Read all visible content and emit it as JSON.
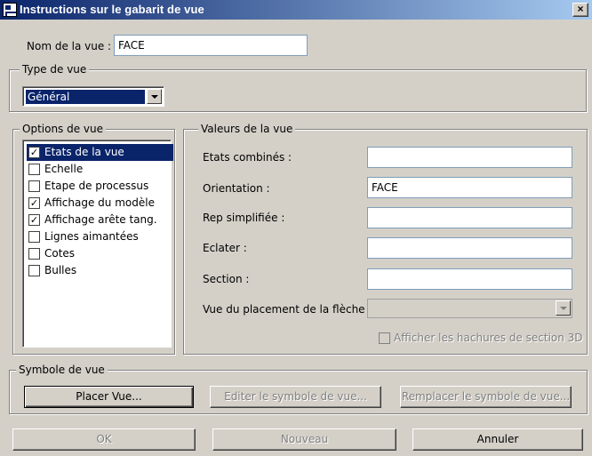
{
  "window": {
    "title": "Instructions sur le gabarit de vue",
    "close_glyph": "×"
  },
  "view_name": {
    "label": "Nom de la vue :",
    "value": "FACE"
  },
  "view_type": {
    "legend": "Type de vue",
    "selected": "Général"
  },
  "view_options": {
    "legend": "Options de vue",
    "items": [
      {
        "label": "Etats de la vue",
        "checked": true,
        "selected": true
      },
      {
        "label": "Echelle",
        "checked": false,
        "selected": false
      },
      {
        "label": "Etape de processus",
        "checked": false,
        "selected": false
      },
      {
        "label": "Affichage du modèle",
        "checked": true,
        "selected": false
      },
      {
        "label": "Affichage arête tang.",
        "checked": true,
        "selected": false
      },
      {
        "label": "Lignes aimantées",
        "checked": false,
        "selected": false
      },
      {
        "label": "Cotes",
        "checked": false,
        "selected": false
      },
      {
        "label": "Bulles",
        "checked": false,
        "selected": false
      }
    ],
    "check_glyph": "✓"
  },
  "view_values": {
    "legend": "Valeurs de la vue",
    "fields": [
      {
        "label": "Etats combinés :",
        "value": ""
      },
      {
        "label": "Orientation :",
        "value": "FACE"
      },
      {
        "label": "Rep simplifiée :",
        "value": ""
      },
      {
        "label": "Eclater :",
        "value": ""
      },
      {
        "label": "Section :",
        "value": ""
      }
    ],
    "arrow_placement_label": "Vue du placement de la flèche :",
    "arrow_placement_value": "",
    "hatch_checkbox_label": "Afficher les hachures de section 3D",
    "hatch_checked": false
  },
  "view_symbol": {
    "legend": "Symbole de vue",
    "place_button": "Placer Vue...",
    "edit_button": "Editer le symbole de vue...",
    "replace_button": "Remplacer le symbole de vue..."
  },
  "footer": {
    "ok_button": "OK",
    "new_button": "Nouveau",
    "cancel_button": "Annuler"
  }
}
